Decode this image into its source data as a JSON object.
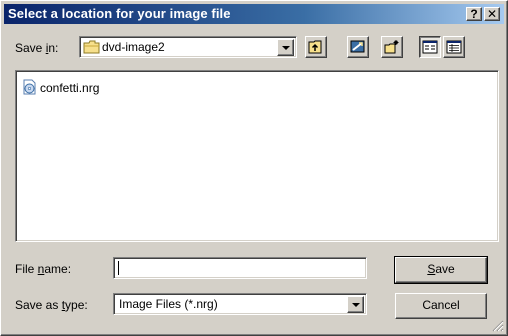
{
  "window": {
    "title": "Select a location for your image file"
  },
  "titlebar_buttons": {
    "help": "?",
    "close": "✕"
  },
  "save_in": {
    "label_pre": "Save ",
    "label_key": "i",
    "label_post": "n:",
    "value": "dvd-image2"
  },
  "toolbar": [
    {
      "name": "up-one-level-icon"
    },
    {
      "name": "desktop-icon"
    },
    {
      "name": "new-folder-icon"
    },
    {
      "name": "list-view-icon"
    },
    {
      "name": "details-view-icon"
    }
  ],
  "files": [
    {
      "name": "confetti.nrg",
      "icon": "nrg-file-icon"
    }
  ],
  "file_name": {
    "label_pre": "File ",
    "label_key": "n",
    "label_post": "ame:",
    "value": ""
  },
  "save_as_type": {
    "label_pre": "Save as ",
    "label_key": "t",
    "label_post": "ype:",
    "value": "Image Files (*.nrg)"
  },
  "buttons": {
    "save": {
      "key": "S",
      "rest": "ave"
    },
    "cancel": "Cancel"
  },
  "colors": {
    "title_start": "#0a246a",
    "title_end": "#a6caf0",
    "face": "#d4d0c8"
  }
}
